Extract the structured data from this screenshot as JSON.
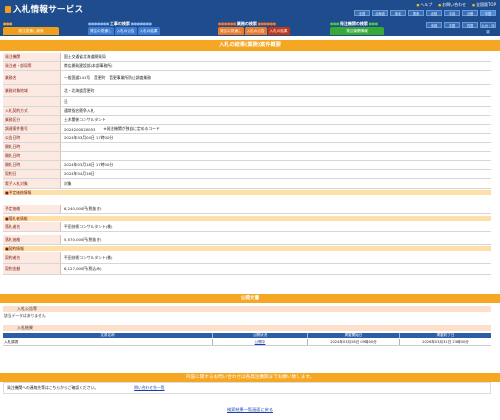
{
  "header": {
    "title": "入札情報サービス",
    "links": [
      "ヘルプ",
      "お問い合わせ",
      "全国版TOP"
    ],
    "regions_top": [
      "全国",
      "北海道",
      "東北",
      "関東",
      "北陸",
      "中部",
      "近畿",
      "中国"
    ],
    "regions_bottom": [
      "沖縄",
      "中国",
      "四国",
      "九州・沖縄"
    ]
  },
  "categories": [
    {
      "label": "工事の検索",
      "tabs": [
        "発注の見通し",
        "入札の公告",
        "入札の結果"
      ]
    },
    {
      "label": "業務の検索",
      "tabs": [
        "発注の見通し",
        "入札の公告",
        "入札の結果"
      ]
    },
    {
      "label": "発注機関の検索",
      "tabs": [
        "発注機関情報"
      ]
    }
  ],
  "left_tab": "発注見通し検索",
  "left_tab2": "",
  "main_title": "入札の結果(業務)案件概要",
  "fields": [
    {
      "label": "発注機関",
      "value": "国土交通省北海道開発局"
    },
    {
      "label": "発注者・部局等",
      "value": "帯広開発建設部(本部事務所)"
    },
    {
      "label": "業務名",
      "value": "一般国道241号　音更町　音更事業所防止調査業務"
    },
    {
      "label": "業務対象地域",
      "value": "北・北海道音更町"
    },
    {
      "label": "",
      "value": "旦"
    },
    {
      "label": "入札契約方式",
      "value": "通常指名競争入札"
    },
    {
      "label": "業務区分",
      "value": "土木関係コンサルタント"
    },
    {
      "label": "調達案件番号",
      "value": "2024200020053",
      "extra": "※発注機関が独自に定めるコード"
    },
    {
      "label": "公告日時",
      "value": "2024年03月04日 17時00分"
    },
    {
      "label": "開札日時",
      "value": ""
    },
    {
      "label": "開札日時",
      "value": ""
    },
    {
      "label": "開札日時",
      "value": "2024年03月18日 17時00分"
    },
    {
      "label": "契約日",
      "value": "2024年04月16日"
    },
    {
      "label": "電子入札対象",
      "value": "対象"
    }
  ],
  "sections": {
    "winner_head": "■予定価格情報",
    "price_label": "予定価格",
    "price_value": "6,240,000円(税抜き)",
    "winner2_head": "■落札者情報",
    "winner_label": "落札者名",
    "winner_value": "平田技術コンサルタント(株)",
    "winner_price_label": "落札価格",
    "winner_price_value": "5,570,000円(税抜き)",
    "contract_head": "■契約情報",
    "contract_label": "契約者名",
    "contract_value": "平田技術コンサルタント(株)",
    "contract_price_label": "契約金額",
    "contract_price_value": "6,127,000円(税込み)"
  },
  "docs_bar": "公開文書",
  "bid_notice_head": "入札公告等",
  "no_data": "該当データはありません",
  "bid_result_head": "入札結果",
  "table": {
    "headers": [
      "文書名称",
      "公開状況",
      "掲載開始日",
      "掲載終了日"
    ],
    "rows": [
      {
        "name": "入札調書",
        "status": "公開中",
        "start": "2024年03月28日 09時00分",
        "end": "2026年03月31日 23時00分"
      }
    ]
  },
  "contact_bar": "内容に関するお問い合わせは各発注機関までお願い致します。",
  "contact_text": "発注機関への連絡先等はこちらからご確認ください。",
  "contact_link": "問い合わせ先一覧",
  "footer_link": "検索結果一覧画面に戻る"
}
